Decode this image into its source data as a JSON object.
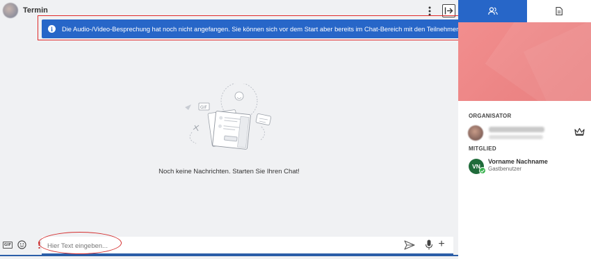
{
  "header": {
    "title": "Termin"
  },
  "banner": {
    "text": "Die Audio-/Video-Besprechung hat noch nicht angefangen. Sie können sich vor dem Start aber bereits im Chat-Bereich mit den Teilnehmern unterhalten."
  },
  "empty_state": {
    "message": "Noch keine Nachrichten. Starten Sie Ihren Chat!",
    "gif_label": "GIF"
  },
  "composer": {
    "gif_label": "GIF",
    "placeholder": "Hier Text eingeben...",
    "plus_label": "+"
  },
  "sidebar": {
    "tabs": [
      {
        "name": "participants",
        "icon": "users-icon",
        "active": true
      },
      {
        "name": "notes",
        "icon": "document-icon",
        "active": false
      }
    ],
    "organizer_label": "ORGANISATOR",
    "member_label": "MITGLIED",
    "member": {
      "initials": "VN",
      "name": "Vorname Nachname",
      "role": "Gastbenutzer"
    }
  },
  "colors": {
    "accent": "#2766c8",
    "banner_bg": "#2766c8",
    "highlight": "#e02a2a",
    "side_banner": "#ec8585",
    "member_avatar": "#1f6b3a",
    "online": "#37b24d"
  }
}
